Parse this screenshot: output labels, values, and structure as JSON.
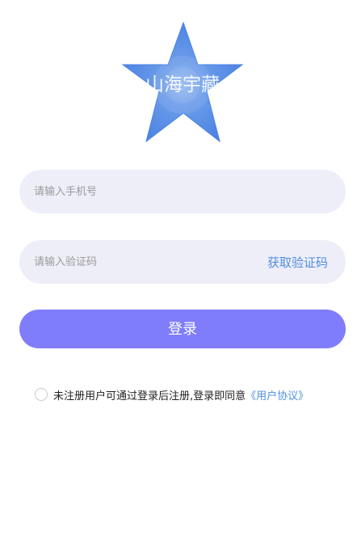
{
  "logo": {
    "text": "山海宇藏",
    "shape": "star",
    "color": "#5a8ee8"
  },
  "phone": {
    "placeholder": "请输入手机号",
    "value": ""
  },
  "code": {
    "placeholder": "请输入验证码",
    "value": "",
    "get_code_label": "获取验证码"
  },
  "login_button": {
    "label": "登录",
    "color": "#7f7dfb"
  },
  "agreement": {
    "checked": false,
    "text": "未注册用户可通过登录后注册,登录即同意",
    "link_text": "《用户协议》",
    "link_color": "#4f8fe0"
  }
}
